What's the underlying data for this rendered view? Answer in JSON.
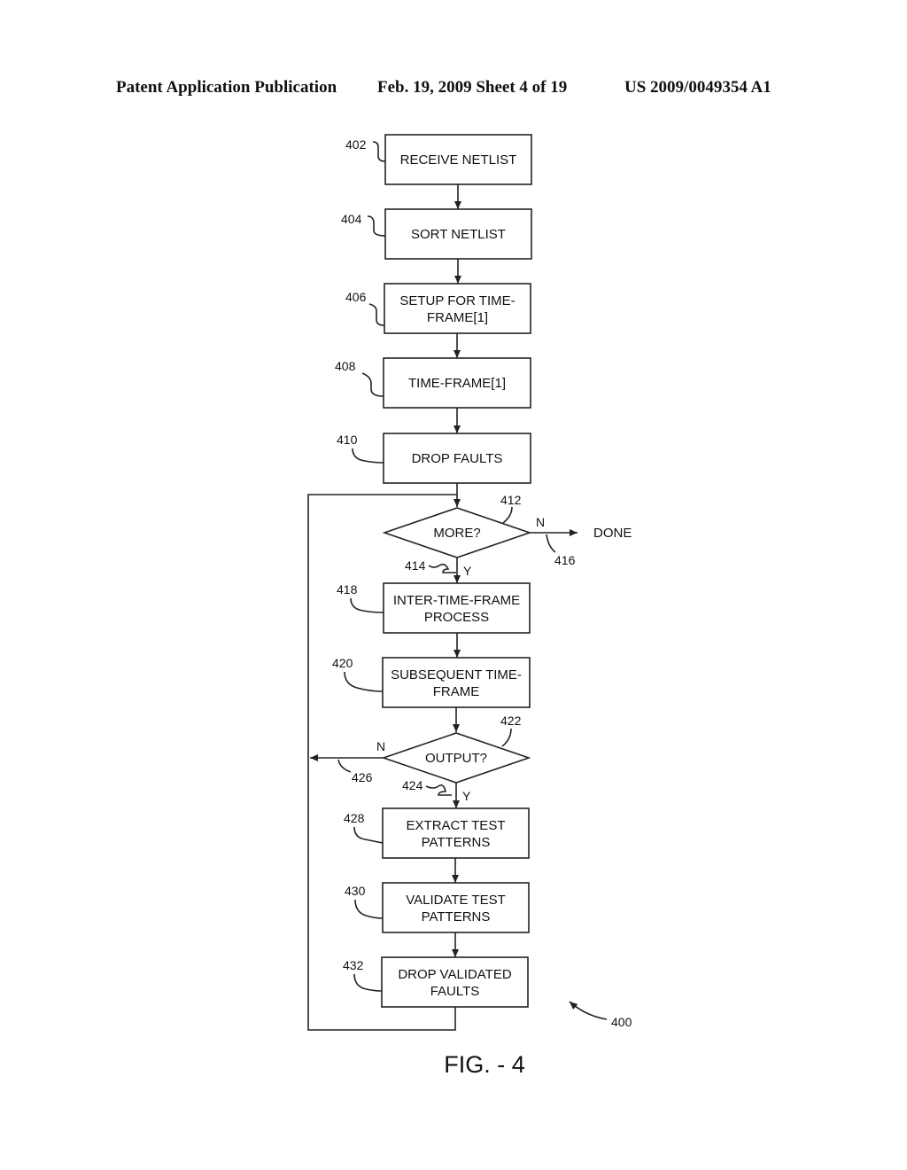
{
  "header": {
    "left": "Patent Application Publication",
    "middle": "Feb. 19, 2009   Sheet 4 of 19",
    "right": "US 2009/0049354 A1"
  },
  "figure": {
    "caption": "FIG. - 4",
    "ref": "400",
    "steps": [
      {
        "ref": "402",
        "lines": [
          "RECEIVE NETLIST"
        ]
      },
      {
        "ref": "404",
        "lines": [
          "SORT NETLIST"
        ]
      },
      {
        "ref": "406",
        "lines": [
          "SETUP FOR TIME-",
          "FRAME[1]"
        ]
      },
      {
        "ref": "408",
        "lines": [
          "TIME-FRAME[1]"
        ]
      },
      {
        "ref": "410",
        "lines": [
          "DROP FAULTS"
        ]
      },
      {
        "ref": "418",
        "lines": [
          "INTER-TIME-FRAME",
          "PROCESS"
        ]
      },
      {
        "ref": "420",
        "lines": [
          "SUBSEQUENT TIME-",
          "FRAME"
        ]
      },
      {
        "ref": "428",
        "lines": [
          "EXTRACT TEST",
          "PATTERNS"
        ]
      },
      {
        "ref": "430",
        "lines": [
          "VALIDATE TEST",
          "PATTERNS"
        ]
      },
      {
        "ref": "432",
        "lines": [
          "DROP VALIDATED",
          "FAULTS"
        ]
      }
    ],
    "decisions": [
      {
        "ref": "412",
        "label": "MORE?",
        "yes": "Y",
        "no": "N",
        "yes_ref": "414",
        "no_ref": "416",
        "no_target": "DONE"
      },
      {
        "ref": "422",
        "label": "OUTPUT?",
        "yes": "Y",
        "no": "N",
        "yes_ref": "424",
        "no_ref": "426"
      }
    ]
  }
}
